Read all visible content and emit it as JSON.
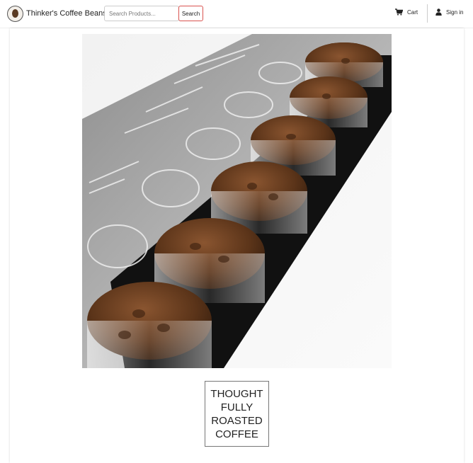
{
  "brand": {
    "name": "Thinker's Coffee Beans",
    "logo_icon": "coffee-bean-logo-icon"
  },
  "search": {
    "placeholder": "Search Products...",
    "value": "",
    "button_label": "Search"
  },
  "nav": {
    "cart_label": "Cart",
    "cart_icon": "cart-icon",
    "signin_label": "Sign in",
    "signin_icon": "user-icon"
  },
  "hero": {
    "image_icon": "coffee-flight-photo"
  },
  "tagline": {
    "lines": [
      "THOUGHT",
      "FULLY",
      "ROASTED",
      "COFFEE"
    ]
  },
  "colors": {
    "search_button_border": "#d9534f",
    "text": "#212529",
    "background": "#ffffff"
  }
}
